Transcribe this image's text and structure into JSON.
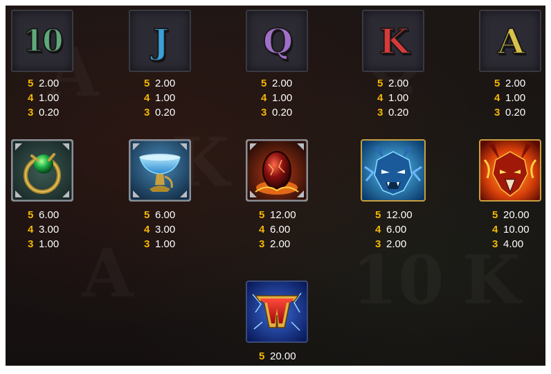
{
  "colors": {
    "count": "#f5b800",
    "value": "#ffffff",
    "background": "#1a1412"
  },
  "symbols": [
    {
      "id": "ten",
      "label": "10",
      "color": "#5fa87a",
      "pays": [
        {
          "count": "5",
          "value": "2.00"
        },
        {
          "count": "4",
          "value": "1.00"
        },
        {
          "count": "3",
          "value": "0.20"
        }
      ]
    },
    {
      "id": "jack",
      "label": "J",
      "color": "#3aa0d8",
      "pays": [
        {
          "count": "5",
          "value": "2.00"
        },
        {
          "count": "4",
          "value": "1.00"
        },
        {
          "count": "3",
          "value": "0.20"
        }
      ]
    },
    {
      "id": "queen",
      "label": "Q",
      "color": "#a070c8",
      "pays": [
        {
          "count": "5",
          "value": "2.00"
        },
        {
          "count": "4",
          "value": "1.00"
        },
        {
          "count": "3",
          "value": "0.20"
        }
      ]
    },
    {
      "id": "king",
      "label": "K",
      "color": "#d83a3a",
      "pays": [
        {
          "count": "5",
          "value": "2.00"
        },
        {
          "count": "4",
          "value": "1.00"
        },
        {
          "count": "3",
          "value": "0.20"
        }
      ]
    },
    {
      "id": "ace",
      "label": "A",
      "color": "#d8c24a",
      "pays": [
        {
          "count": "5",
          "value": "2.00"
        },
        {
          "count": "4",
          "value": "1.00"
        },
        {
          "count": "3",
          "value": "0.20"
        }
      ]
    },
    {
      "id": "green-amulet",
      "icon": "green-gem-amulet-icon",
      "pays": [
        {
          "count": "5",
          "value": "6.00"
        },
        {
          "count": "4",
          "value": "3.00"
        },
        {
          "count": "3",
          "value": "1.00"
        }
      ]
    },
    {
      "id": "blue-chalice",
      "icon": "blue-chalice-icon",
      "pays": [
        {
          "count": "5",
          "value": "6.00"
        },
        {
          "count": "4",
          "value": "3.00"
        },
        {
          "count": "3",
          "value": "1.00"
        }
      ]
    },
    {
      "id": "dragon-egg",
      "icon": "dragon-egg-icon",
      "pays": [
        {
          "count": "5",
          "value": "12.00"
        },
        {
          "count": "4",
          "value": "6.00"
        },
        {
          "count": "3",
          "value": "2.00"
        }
      ]
    },
    {
      "id": "blue-dragon",
      "icon": "blue-dragon-icon",
      "pays": [
        {
          "count": "5",
          "value": "12.00"
        },
        {
          "count": "4",
          "value": "6.00"
        },
        {
          "count": "3",
          "value": "2.00"
        }
      ]
    },
    {
      "id": "fire-dragon",
      "icon": "fire-dragon-icon",
      "pays": [
        {
          "count": "5",
          "value": "20.00"
        },
        {
          "count": "4",
          "value": "10.00"
        },
        {
          "count": "3",
          "value": "4.00"
        }
      ]
    },
    {
      "id": "wild",
      "label": "W",
      "icon": "wild-icon",
      "pays": [
        {
          "count": "5",
          "value": "20.00"
        }
      ]
    }
  ]
}
